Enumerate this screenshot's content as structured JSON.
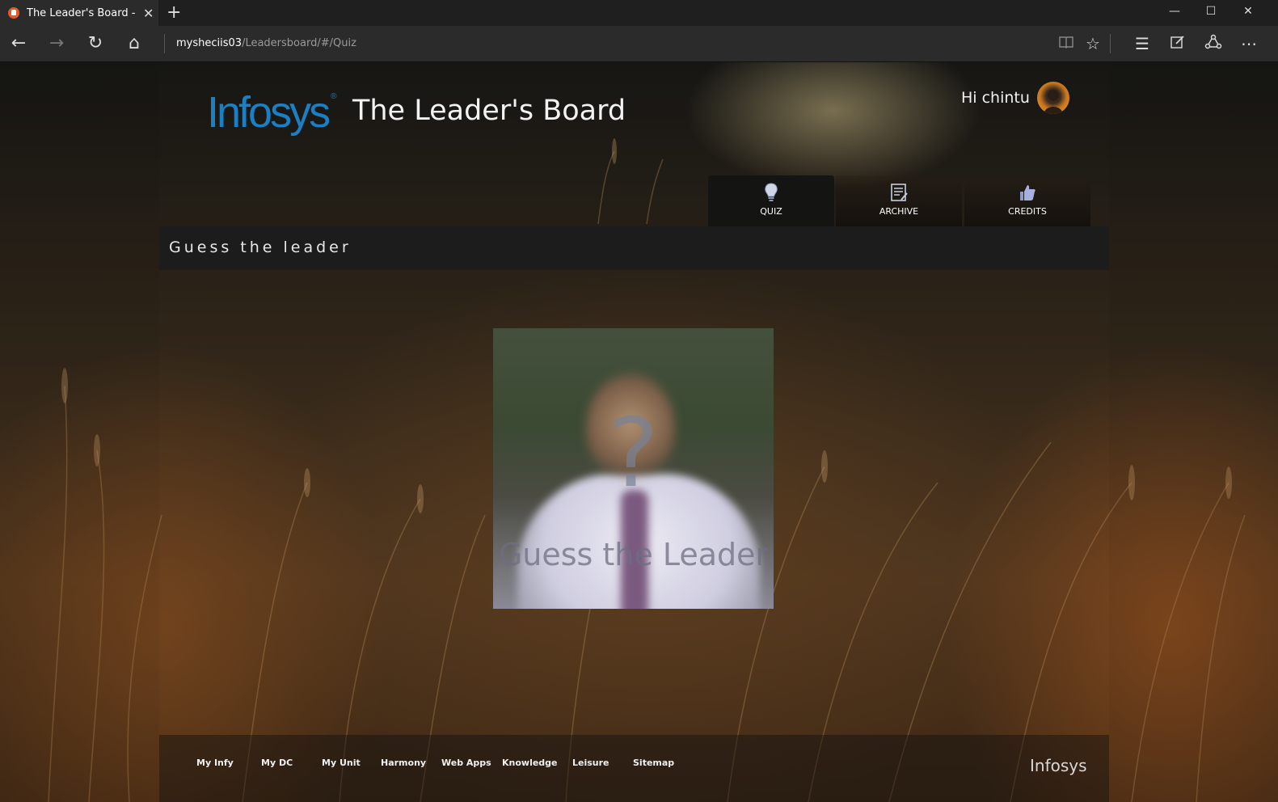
{
  "browser": {
    "tab_title": "The Leader's Board - Gu",
    "address_host": "mysheciis03",
    "address_path": "/Leadersboard/#/Quiz"
  },
  "header": {
    "logo_text": "Infosys",
    "logo_mark": "®",
    "app_title": "The Leader's Board",
    "greeting": "Hi chintu"
  },
  "nav_tabs": [
    {
      "label": "QUIZ",
      "icon": "lightbulb-icon",
      "active": true
    },
    {
      "label": "ARCHIVE",
      "icon": "notepad-icon",
      "active": false
    },
    {
      "label": "CREDITS",
      "icon": "thumbs-up-icon",
      "active": false
    }
  ],
  "section": {
    "title": "Guess the leader"
  },
  "quiz_image": {
    "question_mark": "?",
    "caption": "Guess the Leader"
  },
  "footer": {
    "links": [
      "My Infy",
      "My DC",
      "My Unit",
      "Harmony",
      "Web Apps",
      "Knowledge",
      "Leisure",
      "Sitemap"
    ],
    "brand": "Infosys"
  },
  "colors": {
    "logo_blue": "#1a7fc4",
    "chrome_dark": "#2b2b2b",
    "section_bar": "#1c1c1c"
  }
}
